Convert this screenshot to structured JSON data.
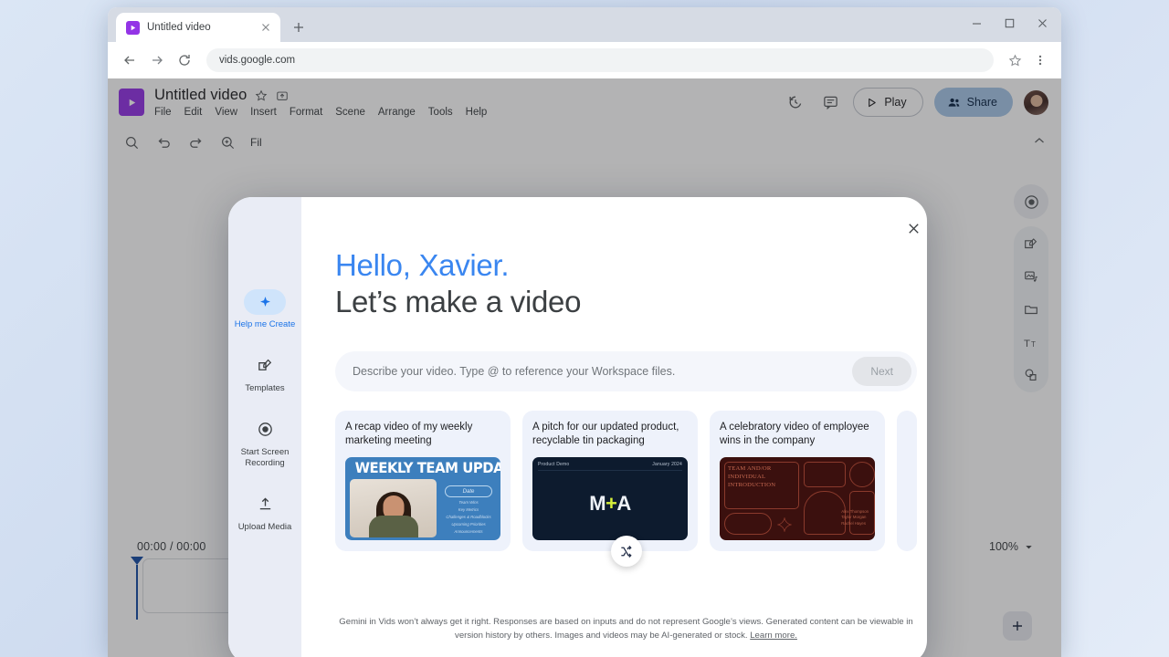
{
  "browser": {
    "tab": {
      "title": "Untitled video",
      "favicon": "vids-icon",
      "close": "close-icon"
    },
    "new_tab": "new-tab-icon",
    "window_controls": {
      "minimize": "minimize-icon",
      "maximize": "maximize-icon",
      "close": "close-icon"
    },
    "nav": {
      "back": "back-arrow-icon",
      "forward": "forward-arrow-icon",
      "reload": "reload-icon"
    },
    "url": "vids.google.com",
    "bookmark": "star-icon",
    "menu": "more-vertical-icon"
  },
  "app": {
    "doc_title": "Untitled video",
    "star_icon": "star-icon",
    "move_icon": "move-to-folder-icon",
    "menus": [
      "File",
      "Edit",
      "View",
      "Insert",
      "Format",
      "Scene",
      "Arrange",
      "Tools",
      "Help"
    ],
    "actions": {
      "history_icon": "version-history-icon",
      "comment_icon": "comment-icon",
      "play_label": "Play",
      "share_label": "Share",
      "avatar": "user-avatar"
    },
    "toolbar": {
      "search_icon": "search-icon",
      "undo_icon": "undo-icon",
      "redo_icon": "redo-icon",
      "zoom_icon": "zoom-in-icon",
      "filter_label": "Fil",
      "collapse_icon": "chevron-up-icon"
    },
    "rail": [
      "record-icon",
      "templates-icon",
      "media-icon",
      "folder-icon",
      "text-icon",
      "shapes-icon"
    ],
    "timeline": {
      "time": "00:00 / 00:00",
      "zoom_level": "100%",
      "zoom_chevron": "chevron-down-icon",
      "add_label": "+"
    }
  },
  "modal": {
    "close_icon": "close-icon",
    "sidebar": [
      {
        "label": "Help me Create",
        "icon": "sparkle-icon",
        "active": true
      },
      {
        "label": "Templates",
        "icon": "templates-icon",
        "active": false
      },
      {
        "label": "Start Screen Recording",
        "icon": "record-icon",
        "active": false
      },
      {
        "label": "Upload Media",
        "icon": "upload-icon",
        "active": false
      }
    ],
    "greeting_line1": "Hello, Xavier.",
    "greeting_line2": "Let’s make a video",
    "prompt_placeholder": "Describe your video. Type @ to reference your Workspace files.",
    "next_label": "Next",
    "shuffle_icon": "shuffle-icon",
    "cards": [
      {
        "title": "A recap video of my weekly marketing meeting",
        "thumb": {
          "style": "weekly-team-updates",
          "heading": "WEEKLY TEAM UPDATES",
          "date_label": "Date",
          "lines": [
            "Team Wins",
            "Key Metrics",
            "Challenges & Roadblocks",
            "Upcoming Priorities",
            "Announcements"
          ]
        }
      },
      {
        "title": "A pitch for our updated product, recyclable tin packaging",
        "thumb": {
          "style": "product-demo",
          "eyebrow_left": "Product Demo",
          "eyebrow_right": "January 2024",
          "logo_left": "M",
          "logo_plus": "+",
          "logo_right": "A"
        }
      },
      {
        "title": "A celebratory video of employee wins in the company",
        "thumb": {
          "style": "team-introduction",
          "heading": "TEAM AND/OR INDIVIDUAL INTRODUCTION",
          "names": [
            "Alex Thompson",
            "Taylor Morgan",
            "Rachel Hayes"
          ]
        }
      }
    ],
    "disclaimer": "Gemini in Vids won’t always get it right. Responses are based on inputs and do not represent Google’s views. Generated content can be viewable in version history by others. Images and videos may be AI-generated or stock.",
    "learn_more": "Learn more."
  },
  "colors": {
    "accent_blue": "#3a86f0",
    "link_blue": "#1a73e8",
    "share_bg": "#a8c7e8",
    "vids_purple": "#9334e6",
    "playhead": "#174ea6"
  }
}
